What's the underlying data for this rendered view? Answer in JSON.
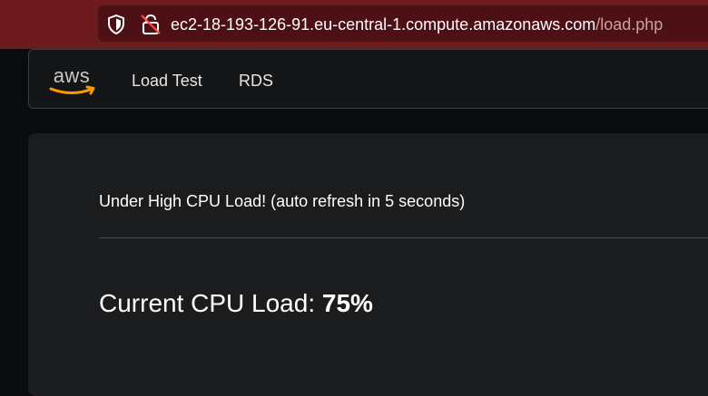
{
  "browser": {
    "url_host": "ec2-18-193-126-91.eu-central-1.compute.amazonaws.com",
    "url_path": "/load.php",
    "icons": [
      "shield-icon",
      "lock-icon"
    ],
    "colors": {
      "toolbar": "#6d1a1f",
      "url_box": "#4d1014"
    }
  },
  "navbar": {
    "logo": "aws-logo",
    "logo_text": "aws",
    "links": [
      {
        "label": "Load Test"
      },
      {
        "label": "RDS"
      }
    ]
  },
  "main": {
    "status": "Under High CPU Load! (auto refresh in 5 seconds)",
    "cpu_label": "Current CPU Load: ",
    "cpu_value": "75%"
  },
  "theme": {
    "page_bg": "#0b0c0d",
    "card_bg": "#1b1c1e",
    "aws_orange": "#ff9900"
  }
}
